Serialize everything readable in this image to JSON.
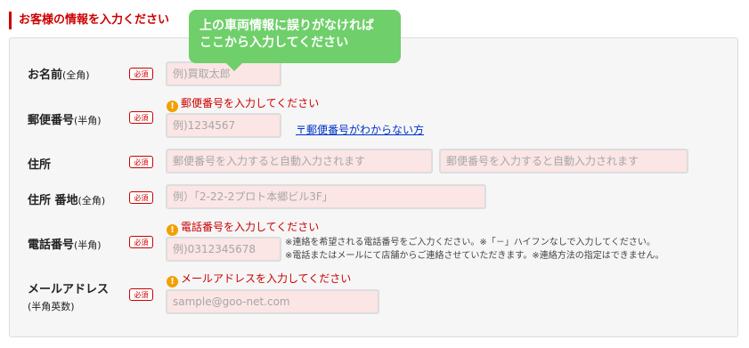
{
  "section_title": "お客様の情報を入力ください",
  "tooltip": {
    "line1": "上の車両情報に誤りがなければ",
    "line2": "ここから入力してください"
  },
  "required_badge": "必須",
  "error_icon": "!",
  "fields": {
    "name": {
      "label": "お名前",
      "sublabel": "(全角)",
      "placeholder": "例)買取太郎"
    },
    "postal": {
      "label": "郵便番号",
      "sublabel": "(半角)",
      "placeholder": "例)1234567",
      "error": "郵便番号を入力してください",
      "link": "〒郵便番号がわからない方"
    },
    "address": {
      "label": "住所",
      "placeholder1": "郵便番号を入力すると自動入力されます",
      "placeholder2": "郵便番号を入力すると自動入力されます"
    },
    "street": {
      "label": "住所 番地",
      "sublabel": "(全角)",
      "placeholder": "例）「2-22-2プロト本郷ビル3F」"
    },
    "phone": {
      "label": "電話番号",
      "sublabel": "(半角)",
      "placeholder": "例)0312345678",
      "error": "電話番号を入力してください",
      "note1": "※連絡を希望される電話番号をご入力ください。※「－」ハイフンなしで入力してください。",
      "note2": "※電話またはメールにて店舗からご連絡させていただきます。※連絡方法の指定はできません。"
    },
    "email": {
      "label": "メールアドレス",
      "sublabel": "(半角英数)",
      "placeholder": "sample@goo-net.com",
      "error": "メールアドレスを入力してください"
    }
  },
  "colors": {
    "accent_red": "#cc0000",
    "tooltip_green": "#6fcf6a",
    "input_bg": "#fbe5e5",
    "error_icon_orange": "#f2a000",
    "link_blue": "#0033cc"
  }
}
